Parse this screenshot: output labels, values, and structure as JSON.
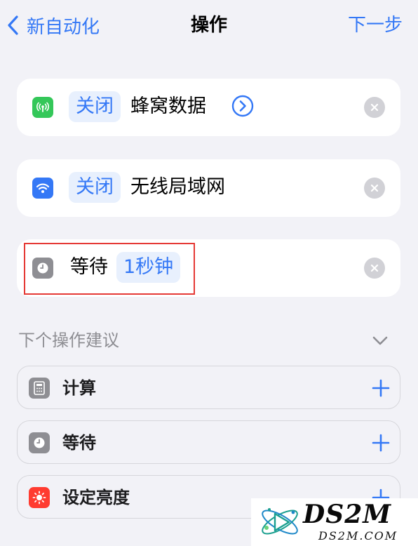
{
  "nav": {
    "back_label": "新自动化",
    "title": "操作",
    "next_label": "下一步"
  },
  "actions": [
    {
      "toggle": "关闭",
      "target": "蜂窝数据",
      "icon": "cellular-icon",
      "icon_color": "#34c759"
    },
    {
      "toggle": "关闭",
      "target": "无线局域网",
      "icon": "wifi-icon",
      "icon_color": "#3478f6"
    },
    {
      "verb": "等待",
      "value": "1秒钟",
      "icon": "clock-icon",
      "icon_color": "#8e8e93"
    }
  ],
  "suggestions": {
    "title": "下个操作建议",
    "items": [
      {
        "label": "计算",
        "icon": "calculator-icon",
        "icon_color": "#8e8e93"
      },
      {
        "label": "等待",
        "icon": "clock-icon",
        "icon_color": "#8e8e93"
      },
      {
        "label": "设定亮度",
        "icon": "brightness-icon",
        "icon_color": "#ff3b30"
      }
    ]
  },
  "watermark": {
    "main": "DS2M",
    "sub": "DS2M.COM"
  },
  "colors": {
    "accent": "#3478f6",
    "background": "#f2f2f7",
    "highlight_border": "#e53935"
  }
}
